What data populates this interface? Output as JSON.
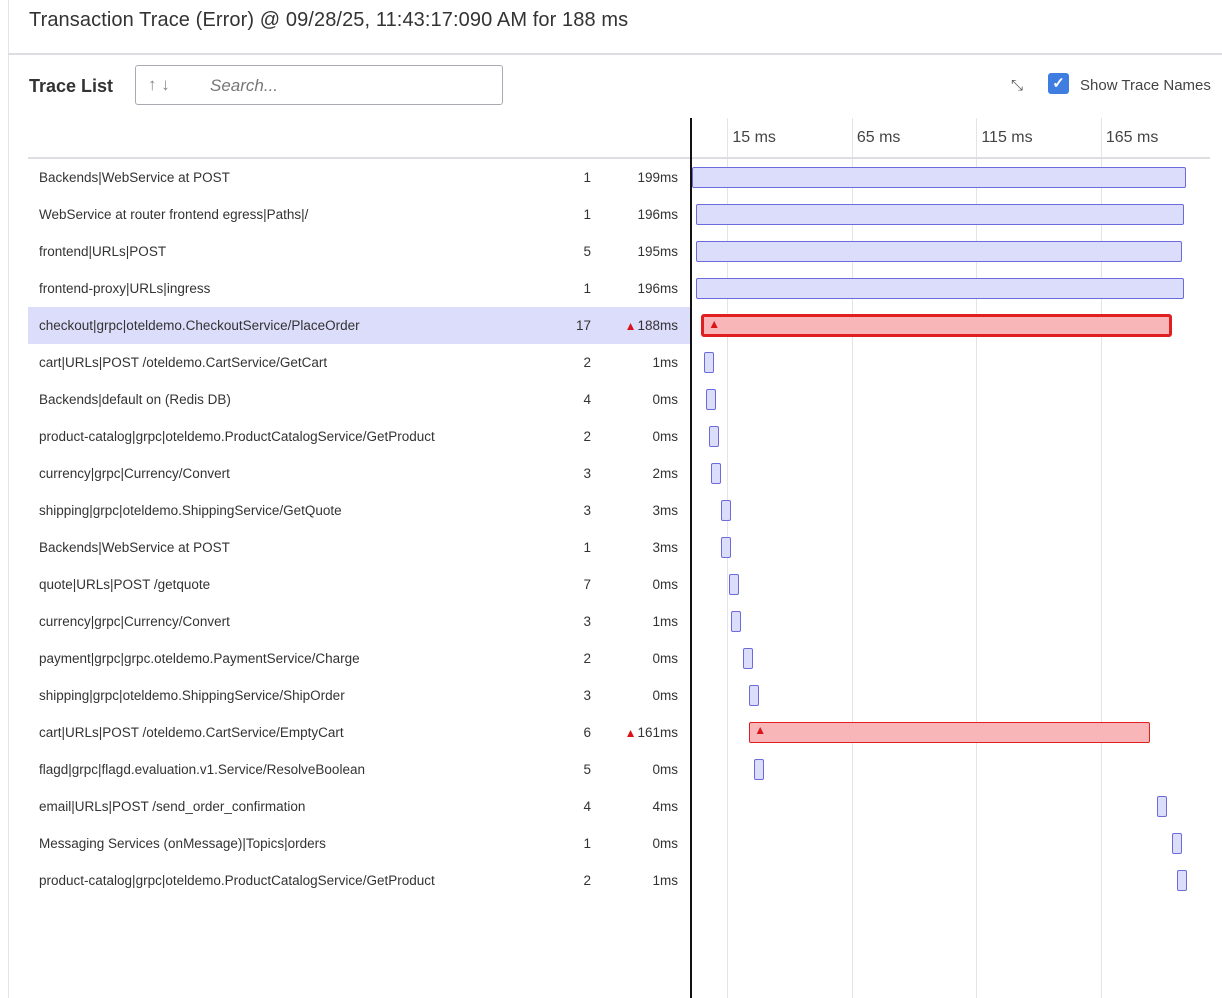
{
  "header": {
    "title": "Transaction Trace (Error) @ 09/28/25, 11:43:17:090 AM for 188 ms"
  },
  "toolbar": {
    "trace_list_label": "Trace List",
    "search_placeholder": "Search...",
    "sort_arrows": "↑ ↓",
    "show_trace_names_label": "Show Trace Names",
    "show_trace_names_checked": true
  },
  "timeline": {
    "ticks": [
      "15 ms",
      "65 ms",
      "115 ms",
      "165 ms"
    ],
    "tick_values_ms": [
      15,
      65,
      115,
      165
    ]
  },
  "colors": {
    "bar_fill": "#dcdcfb",
    "bar_border": "#6b6bdc",
    "error_fill": "#f8b6b8",
    "error_border": "#e02020",
    "selected_row": "#dcdcfb"
  },
  "rows": [
    {
      "name": "Backends|WebService at POST",
      "count": "1",
      "duration": "199ms",
      "start_ms": 0.8,
      "dur_ms": 198.5,
      "error": false
    },
    {
      "name": "WebService at router frontend egress|Paths|/",
      "count": "1",
      "duration": "196ms",
      "start_ms": 2.5,
      "dur_ms": 196,
      "error": false
    },
    {
      "name": "frontend|URLs|POST",
      "count": "5",
      "duration": "195ms",
      "start_ms": 2.5,
      "dur_ms": 195,
      "error": false
    },
    {
      "name": "frontend-proxy|URLs|ingress",
      "count": "1",
      "duration": "196ms",
      "start_ms": 2.5,
      "dur_ms": 196,
      "error": false
    },
    {
      "name": "checkout|grpc|oteldemo.CheckoutService/PlaceOrder",
      "count": "17",
      "duration": "188ms",
      "start_ms": 4.5,
      "dur_ms": 189,
      "error": true,
      "selected": true
    },
    {
      "name": "cart|URLs|POST /oteldemo.CartService/GetCart",
      "count": "2",
      "duration": "1ms",
      "start_ms": 5.6,
      "dur_ms": 1,
      "error": false
    },
    {
      "name": "Backends|default on (Redis DB)",
      "count": "4",
      "duration": "0ms",
      "start_ms": 6.4,
      "dur_ms": 0,
      "error": false
    },
    {
      "name": "product-catalog|grpc|oteldemo.ProductCatalogService/GetProduct",
      "count": "2",
      "duration": "0ms",
      "start_ms": 7.6,
      "dur_ms": 0,
      "error": false
    },
    {
      "name": "currency|grpc|Currency/Convert",
      "count": "3",
      "duration": "2ms",
      "start_ms": 8.4,
      "dur_ms": 2,
      "error": false
    },
    {
      "name": "shipping|grpc|oteldemo.ShippingService/GetQuote",
      "count": "3",
      "duration": "3ms",
      "start_ms": 12.4,
      "dur_ms": 3,
      "error": false
    },
    {
      "name": "Backends|WebService at POST",
      "count": "1",
      "duration": "3ms",
      "start_ms": 12.4,
      "dur_ms": 3,
      "error": false
    },
    {
      "name": "quote|URLs|POST /getquote",
      "count": "7",
      "duration": "0ms",
      "start_ms": 15.8,
      "dur_ms": 0,
      "error": false
    },
    {
      "name": "currency|grpc|Currency/Convert",
      "count": "3",
      "duration": "1ms",
      "start_ms": 16.6,
      "dur_ms": 1,
      "error": false
    },
    {
      "name": "payment|grpc|grpc.oteldemo.PaymentService/Charge",
      "count": "2",
      "duration": "0ms",
      "start_ms": 21.4,
      "dur_ms": 0,
      "error": false
    },
    {
      "name": "shipping|grpc|oteldemo.ShippingService/ShipOrder",
      "count": "3",
      "duration": "0ms",
      "start_ms": 23.8,
      "dur_ms": 0,
      "error": false
    },
    {
      "name": "cart|URLs|POST /oteldemo.CartService/EmptyCart",
      "count": "6",
      "duration": "161ms",
      "start_ms": 23.8,
      "dur_ms": 161,
      "error": true
    },
    {
      "name": "flagd|grpc|flagd.evaluation.v1.Service/ResolveBoolean",
      "count": "5",
      "duration": "0ms",
      "start_ms": 25.8,
      "dur_ms": 0,
      "error": false
    },
    {
      "name": "email|URLs|POST /send_order_confirmation",
      "count": "4",
      "duration": "4ms",
      "start_ms": 187.6,
      "dur_ms": 4,
      "error": false
    },
    {
      "name": "Messaging Services (onMessage)|Topics|orders",
      "count": "1",
      "duration": "0ms",
      "start_ms": 193.6,
      "dur_ms": 0,
      "error": false
    },
    {
      "name": "product-catalog|grpc|oteldemo.ProductCatalogService/GetProduct",
      "count": "2",
      "duration": "1ms",
      "start_ms": 195.6,
      "dur_ms": 1,
      "error": false
    }
  ]
}
